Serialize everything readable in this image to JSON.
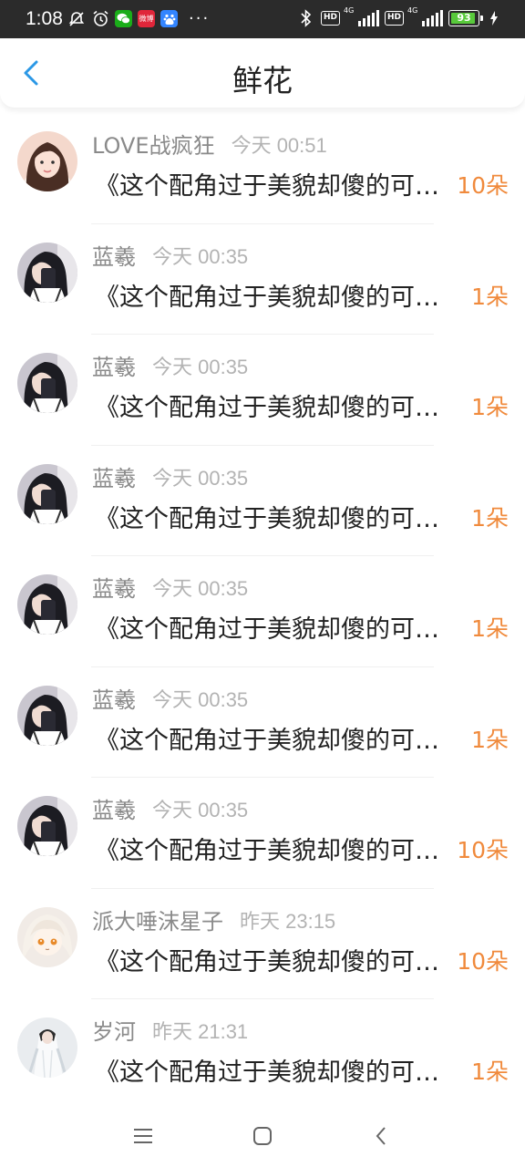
{
  "status_bar": {
    "time": "1:08",
    "apps": [
      "WeChat",
      "ub",
      "baidu"
    ],
    "app_texts": [
      "",
      "微博",
      "du"
    ],
    "more": "···",
    "hd1": "HD",
    "net1": "4G",
    "hd2": "HD",
    "net2": "4G",
    "battery": "93",
    "battery_level": 0.93,
    "icons": [
      "mute-icon",
      "alarm-icon",
      "bluetooth-icon",
      "charging-icon"
    ]
  },
  "header": {
    "title": "鲜花",
    "back_icon": "chevron-left-icon"
  },
  "colors": {
    "count": "#f08a3c",
    "name": "#8a8a8a",
    "time": "#b3b3b3",
    "back": "#2b98e6"
  },
  "items": [
    {
      "name": "LOVE战疯狂",
      "time": "今天 00:51",
      "title": "《这个配角过于美貌却傻的可爱》",
      "count": "10朵",
      "avatar": "girl-pink-avatar"
    },
    {
      "name": "蓝羲",
      "time": "今天 00:35",
      "title": "《这个配角过于美貌却傻的可爱》",
      "count": "1朵",
      "avatar": "girl-dark-avatar"
    },
    {
      "name": "蓝羲",
      "time": "今天 00:35",
      "title": "《这个配角过于美貌却傻的可爱》",
      "count": "1朵",
      "avatar": "girl-dark-avatar"
    },
    {
      "name": "蓝羲",
      "time": "今天 00:35",
      "title": "《这个配角过于美貌却傻的可爱》",
      "count": "1朵",
      "avatar": "girl-dark-avatar"
    },
    {
      "name": "蓝羲",
      "time": "今天 00:35",
      "title": "《这个配角过于美貌却傻的可爱》",
      "count": "1朵",
      "avatar": "girl-dark-avatar"
    },
    {
      "name": "蓝羲",
      "time": "今天 00:35",
      "title": "《这个配角过于美貌却傻的可爱》",
      "count": "1朵",
      "avatar": "girl-dark-avatar"
    },
    {
      "name": "蓝羲",
      "time": "今天 00:35",
      "title": "《这个配角过于美貌却傻的可爱》",
      "count": "10朵",
      "avatar": "girl-dark-avatar"
    },
    {
      "name": "派大唾沫星子",
      "time": "昨天 23:15",
      "title": "《这个配角过于美貌却傻的可爱》",
      "count": "10朵",
      "avatar": "anime-girl-avatar"
    },
    {
      "name": "岁河",
      "time": "昨天 21:31",
      "title": "《这个配角过于美貌却傻的可爱》",
      "count": "1朵",
      "avatar": "white-robe-avatar"
    }
  ],
  "nav": {
    "menu_icon": "menu-icon",
    "home_icon": "home-icon",
    "back_icon": "back-icon"
  }
}
